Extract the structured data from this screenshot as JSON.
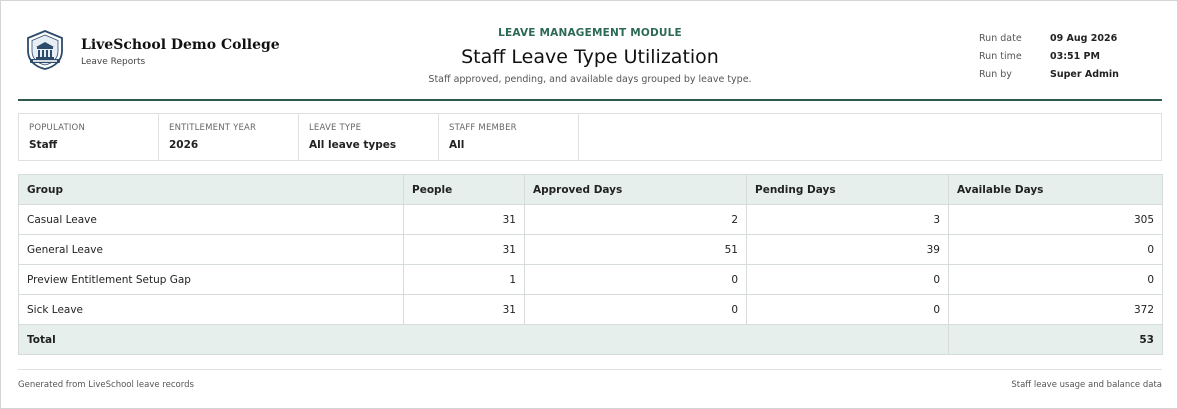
{
  "org": {
    "name": "LiveSchool Demo College",
    "subtitle": "Leave Reports",
    "accent_color": "#2f5a4e",
    "logo_icon": "school-crest-icon"
  },
  "report": {
    "module": "LEAVE MANAGEMENT MODULE",
    "title": "Staff Leave Type Utilization",
    "subtitle": "Staff approved, pending, and available days grouped by leave type."
  },
  "meta": [
    {
      "label": "Run date",
      "value": "09 Aug 2026"
    },
    {
      "label": "Run time",
      "value": "03:51 PM"
    },
    {
      "label": "Run by",
      "value": "Super Admin"
    }
  ],
  "filters": [
    {
      "label": "POPULATION",
      "value": "Staff"
    },
    {
      "label": "ENTITLEMENT YEAR",
      "value": "2026"
    },
    {
      "label": "LEAVE TYPE",
      "value": "All leave types"
    },
    {
      "label": "STAFF MEMBER",
      "value": "All"
    }
  ],
  "table": {
    "columns": [
      "Group",
      "People",
      "Approved Days",
      "Pending Days",
      "Available Days"
    ],
    "rows": [
      [
        "Casual Leave",
        "31",
        "2",
        "3",
        "305"
      ],
      [
        "General Leave",
        "31",
        "51",
        "39",
        "0"
      ],
      [
        "Preview Entitlement Setup Gap",
        "1",
        "0",
        "0",
        "0"
      ],
      [
        "Sick Leave",
        "31",
        "0",
        "0",
        "372"
      ]
    ],
    "total": {
      "label": "Total",
      "value": "53"
    }
  },
  "footer": {
    "left": "Generated from LiveSchool leave records",
    "right": "Staff leave usage and balance data"
  }
}
